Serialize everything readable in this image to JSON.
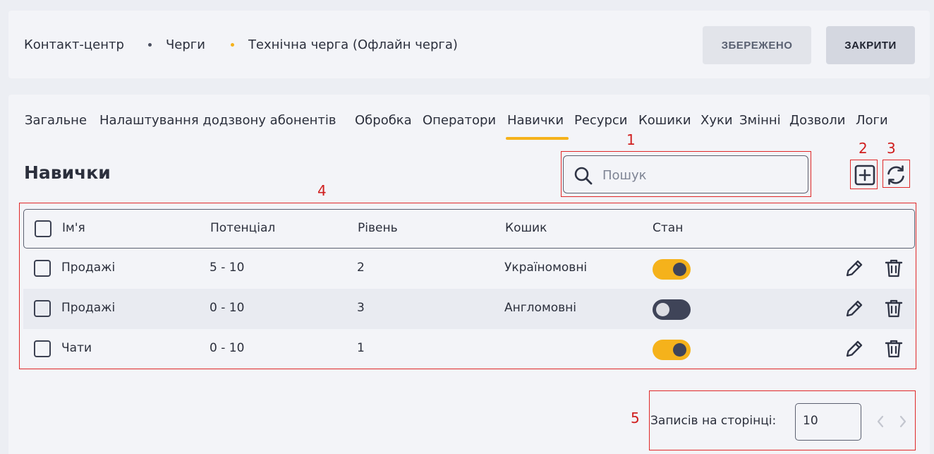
{
  "breadcrumb": {
    "items": [
      "Контакт-центр",
      "Черги",
      "Технічна черга (Офлайн черга)"
    ]
  },
  "header_buttons": {
    "saved_label": "ЗБЕРЕЖЕНО",
    "close_label": "ЗАКРИТИ"
  },
  "tabs": [
    {
      "label": "Загальне"
    },
    {
      "label": "Налаштування додзвону абонентів"
    },
    {
      "label": "Обробка"
    },
    {
      "label": "Оператори"
    },
    {
      "label": "Навички",
      "active": true
    },
    {
      "label": "Ресурси"
    },
    {
      "label": "Кошики"
    },
    {
      "label": "Хуки"
    },
    {
      "label": "Змінні"
    },
    {
      "label": "Дозволи"
    },
    {
      "label": "Логи"
    }
  ],
  "page": {
    "title": "Навички"
  },
  "search": {
    "placeholder": "Пошук",
    "value": ""
  },
  "icons": {
    "search": "search-icon",
    "add": "plus-square-icon",
    "refresh": "refresh-icon",
    "edit": "pencil-icon",
    "delete": "trash-icon"
  },
  "table": {
    "columns": [
      "Ім'я",
      "Потенціал",
      "Рівень",
      "Кошик",
      "Стан"
    ],
    "rows": [
      {
        "name": "Продажі",
        "potential": "5 - 10",
        "level": "2",
        "bucket": "Україномовні",
        "enabled": true
      },
      {
        "name": "Продажі",
        "potential": "0 - 10",
        "level": "3",
        "bucket": "Англомовні",
        "enabled": false
      },
      {
        "name": "Чати",
        "potential": "0 - 10",
        "level": "1",
        "bucket": "",
        "enabled": true
      }
    ]
  },
  "pagination": {
    "label": "Записів на сторінці:",
    "per_page": "10"
  },
  "annotations": [
    "1",
    "2",
    "3",
    "4",
    "5"
  ],
  "colors": {
    "accent": "#f5b21b",
    "toggle_off": "#3f4458",
    "annotation": "#e02828"
  }
}
